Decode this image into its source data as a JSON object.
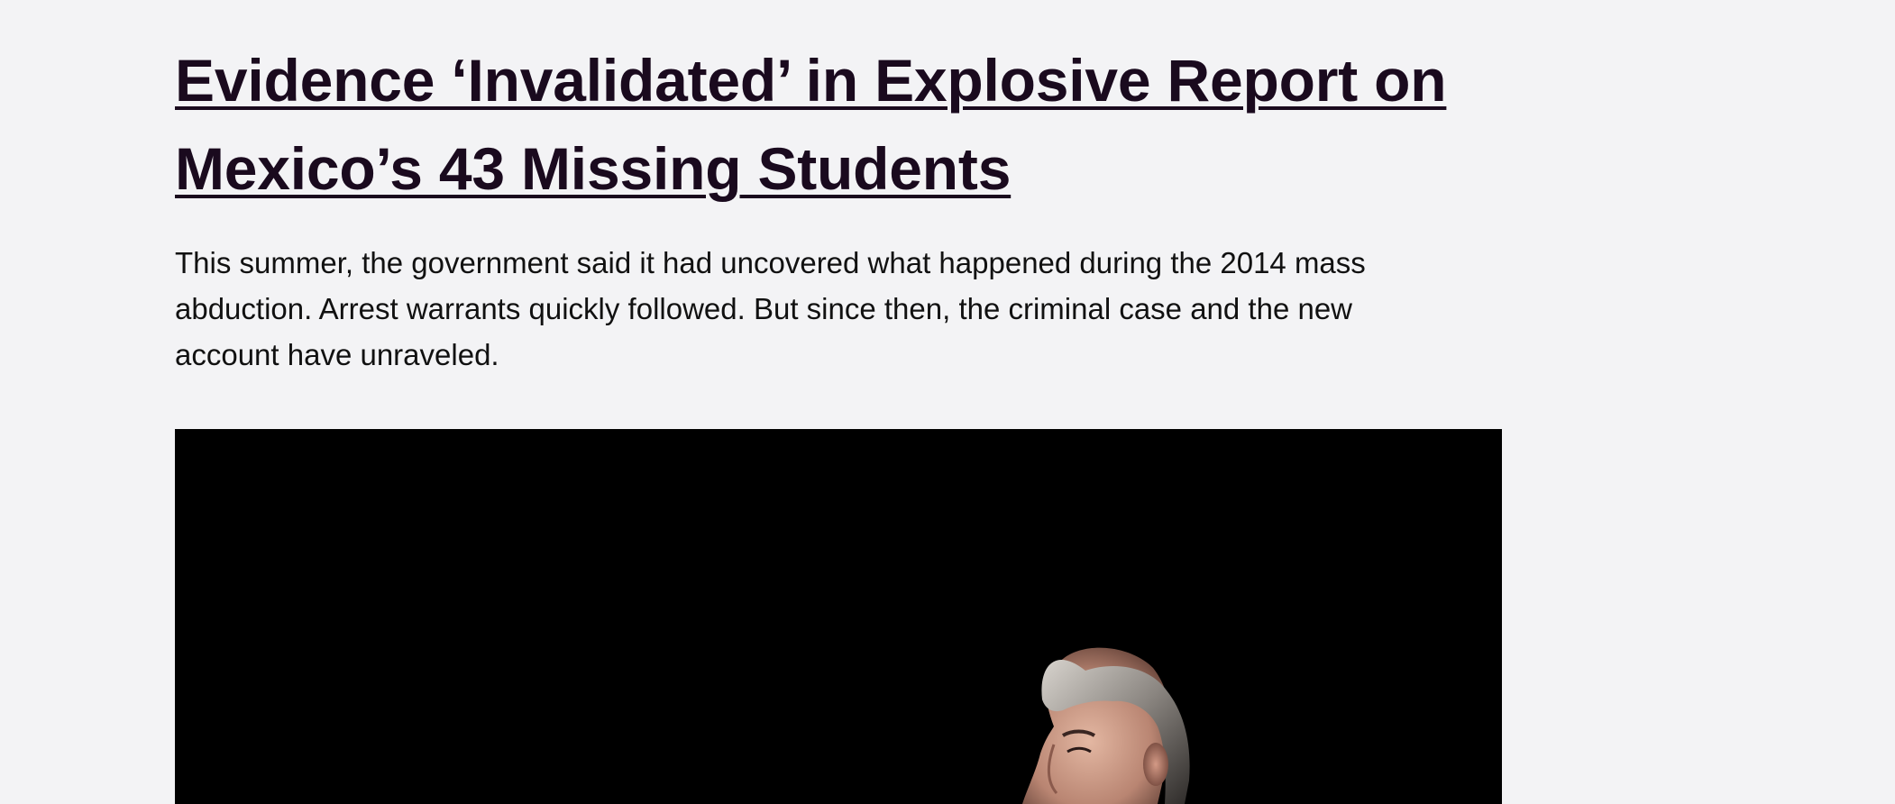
{
  "article": {
    "headline": "Evidence ‘Invalidated’ in Explosive Report on Mexico’s 43 Missing Students",
    "summary": "This summer, the government said it had uncovered what happened during the 2014 mass abduction. Arrest warrants quickly followed. But since then, the criminal case and the new account have unraveled."
  },
  "colors": {
    "background": "#f3f3f5",
    "headline": "#1a0a1e",
    "body_text": "#111111",
    "image_background": "#000000"
  }
}
